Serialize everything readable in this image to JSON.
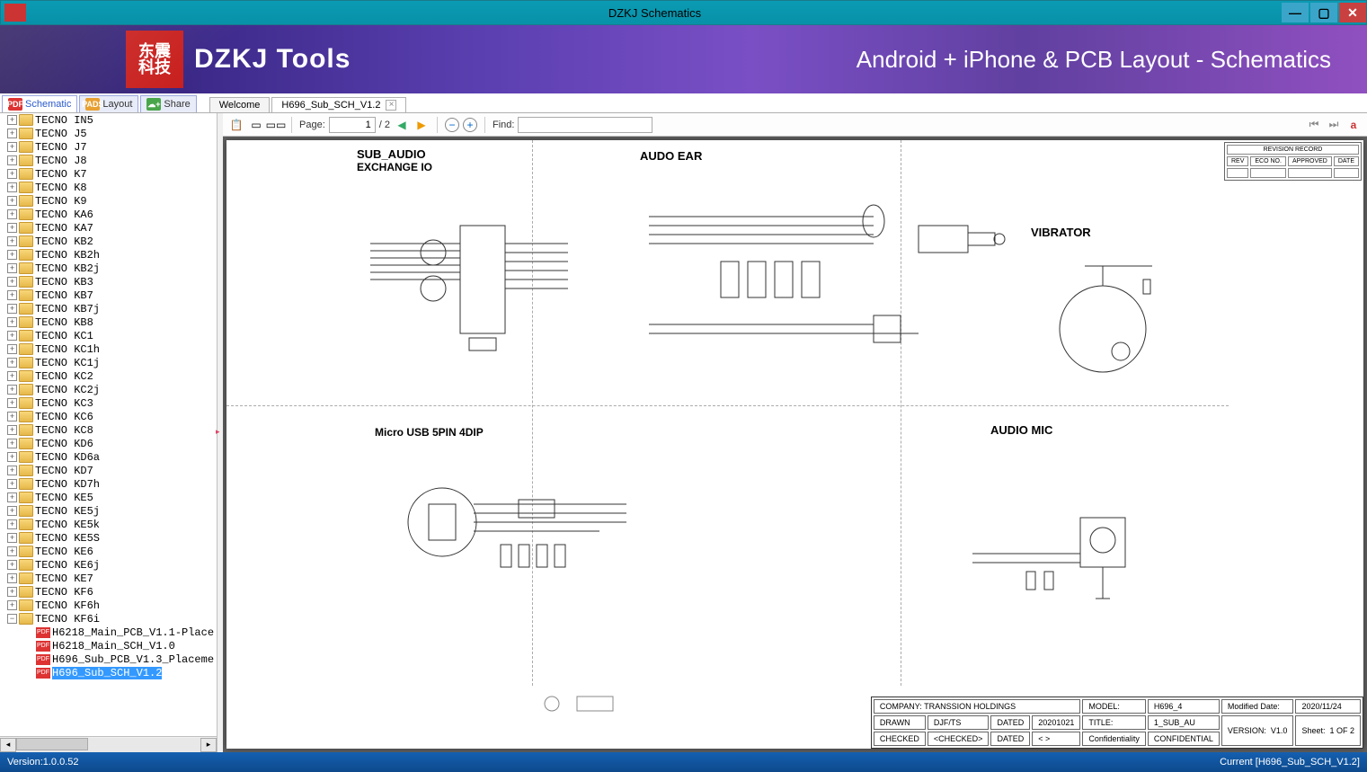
{
  "window": {
    "title": "DZKJ Schematics"
  },
  "banner": {
    "logo_cn": "东震\n科技",
    "logo_text": "DZKJ Tools",
    "tagline": "Android + iPhone & PCB Layout - Schematics"
  },
  "main_tabs": [
    {
      "icon": "PDF",
      "icon_bg": "#d33",
      "label": "Schematic",
      "color": "#2a5acc"
    },
    {
      "icon": "PADS",
      "icon_bg": "#e8a030",
      "label": "Layout",
      "color": "#333"
    },
    {
      "icon": "☁+",
      "icon_bg": "#4aa64a",
      "label": "Share",
      "color": "#333"
    }
  ],
  "doc_tabs": [
    {
      "label": "Welcome",
      "closable": false
    },
    {
      "label": "H696_Sub_SCH_V1.2",
      "closable": true,
      "active": true
    }
  ],
  "toolbar": {
    "page_label": "Page:",
    "page_current": "1",
    "page_total": "/ 2",
    "find_label": "Find:",
    "find_value": ""
  },
  "tree": {
    "folders": [
      "TECNO IN5",
      "TECNO J5",
      "TECNO J7",
      "TECNO J8",
      "TECNO K7",
      "TECNO K8",
      "TECNO K9",
      "TECNO KA6",
      "TECNO KA7",
      "TECNO KB2",
      "TECNO KB2h",
      "TECNO KB2j",
      "TECNO KB3",
      "TECNO KB7",
      "TECNO KB7j",
      "TECNO KB8",
      "TECNO KC1",
      "TECNO KC1h",
      "TECNO KC1j",
      "TECNO KC2",
      "TECNO KC2j",
      "TECNO KC3",
      "TECNO KC6",
      "TECNO KC8",
      "TECNO KD6",
      "TECNO KD6a",
      "TECNO KD7",
      "TECNO KD7h",
      "TECNO KE5",
      "TECNO KE5j",
      "TECNO KE5k",
      "TECNO KE5S",
      "TECNO KE6",
      "TECNO KE6j",
      "TECNO KE7",
      "TECNO KF6",
      "TECNO KF6h"
    ],
    "open_folder": "TECNO KF6i",
    "files": [
      "H6218_Main_PCB_V1.1-Place",
      "H6218_Main_SCH_V1.0",
      "H696_Sub_PCB_V1.3_Placeme",
      "H696_Sub_SCH_V1.2"
    ],
    "selected_file": "H696_Sub_SCH_V1.2"
  },
  "schematic": {
    "sections": {
      "sub_audio": {
        "title": "SUB_AUDIO",
        "subtitle": "EXCHANGE IO"
      },
      "audo_ear": {
        "title": "AUDO EAR"
      },
      "vibrator": {
        "title": "VIBRATOR"
      },
      "micro_usb": {
        "title": "Micro USB 5PIN 4DIP"
      },
      "audio_mic": {
        "title": "AUDIO MIC"
      }
    },
    "revblock_headers": [
      "REV",
      "ECO NO.",
      "APPROVED",
      "DATE"
    ],
    "titleblock": {
      "company_label": "COMPANY:",
      "company": "TRANSSION HOLDINGS",
      "model_label": "MODEL:",
      "model": "H696_4",
      "modified_label": "Modified Date:",
      "modified": "2020/11/24",
      "drawn_label": "DRAWN",
      "drawn": "DJF/TS",
      "dated1_label": "DATED",
      "dated1": "20201021",
      "title_label": "TITLE:",
      "title": "1_SUB_AU",
      "version_label": "VERSION:",
      "version": "V1.0",
      "sheet_label": "Sheet:",
      "sheet": "1  OF     2",
      "checked_label": "CHECKED",
      "checked": "<CHECKED>",
      "dated2_label": "DATED",
      "dated2": "<  >",
      "conf_label": "Confidentiality",
      "conf": "CONFIDENTIAL"
    }
  },
  "statusbar": {
    "version": "Version:1.0.0.52",
    "current": "Current [H696_Sub_SCH_V1.2]"
  }
}
